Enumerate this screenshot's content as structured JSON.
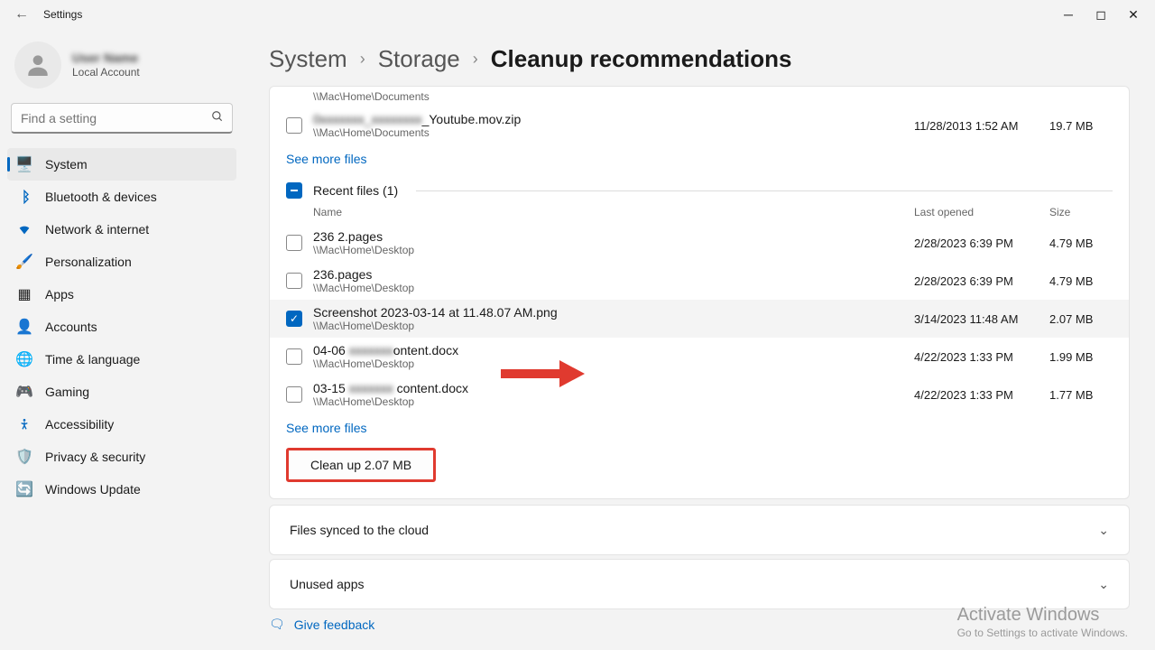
{
  "app": {
    "title": "Settings"
  },
  "user": {
    "name": "User Name",
    "subtitle": "Local Account"
  },
  "search": {
    "placeholder": "Find a setting"
  },
  "nav": [
    {
      "id": "system",
      "label": "System",
      "icon": "🖥️",
      "active": true
    },
    {
      "id": "bluetooth",
      "label": "Bluetooth & devices",
      "icon": "bt"
    },
    {
      "id": "network",
      "label": "Network & internet",
      "icon": "wifi"
    },
    {
      "id": "personalization",
      "label": "Personalization",
      "icon": "🖌️"
    },
    {
      "id": "apps",
      "label": "Apps",
      "icon": "▦"
    },
    {
      "id": "accounts",
      "label": "Accounts",
      "icon": "👤"
    },
    {
      "id": "time",
      "label": "Time & language",
      "icon": "🌐"
    },
    {
      "id": "gaming",
      "label": "Gaming",
      "icon": "🎮"
    },
    {
      "id": "accessibility",
      "label": "Accessibility",
      "icon": "acc"
    },
    {
      "id": "privacy",
      "label": "Privacy & security",
      "icon": "🛡️"
    },
    {
      "id": "update",
      "label": "Windows Update",
      "icon": "🔄"
    }
  ],
  "breadcrumb": {
    "l1": "System",
    "l2": "Storage",
    "current": "Cleanup recommendations"
  },
  "top_section": {
    "truncated_path": "\\\\Mac\\Home\\Documents",
    "file": {
      "name_suffix": "_Youtube.mov.zip",
      "path": "\\\\Mac\\Home\\Documents",
      "date": "11/28/2013 1:52 AM",
      "size": "19.7 MB"
    },
    "see_more": "See more files"
  },
  "recent": {
    "title": "Recent files (1)",
    "cols": {
      "name": "Name",
      "date": "Last opened",
      "size": "Size"
    },
    "files": [
      {
        "name": "236 2.pages",
        "path": "\\\\Mac\\Home\\Desktop",
        "date": "2/28/2023 6:39 PM",
        "size": "4.79 MB",
        "checked": false
      },
      {
        "name": "236.pages",
        "path": "\\\\Mac\\Home\\Desktop",
        "date": "2/28/2023 6:39 PM",
        "size": "4.79 MB",
        "checked": false
      },
      {
        "name": "Screenshot 2023-03-14 at 11.48.07 AM.png",
        "path": "\\\\Mac\\Home\\Desktop",
        "date": "3/14/2023 11:48 AM",
        "size": "2.07 MB",
        "checked": true
      },
      {
        "name_prefix": "04-06 ",
        "name_suffix": "ontent.docx",
        "path": "\\\\Mac\\Home\\Desktop",
        "date": "4/22/2023 1:33 PM",
        "size": "1.99 MB",
        "checked": false,
        "masked": true
      },
      {
        "name_prefix": "03-15 ",
        "name_suffix": " content.docx",
        "path": "\\\\Mac\\Home\\Desktop",
        "date": "4/22/2023 1:33 PM",
        "size": "1.77 MB",
        "checked": false,
        "masked": true
      }
    ],
    "see_more": "See more files",
    "cleanup": "Clean up 2.07 MB"
  },
  "expanders": {
    "cloud": "Files synced to the cloud",
    "apps": "Unused apps"
  },
  "feedback": "Give feedback",
  "watermark": {
    "l1": "Activate Windows",
    "l2": "Go to Settings to activate Windows."
  }
}
